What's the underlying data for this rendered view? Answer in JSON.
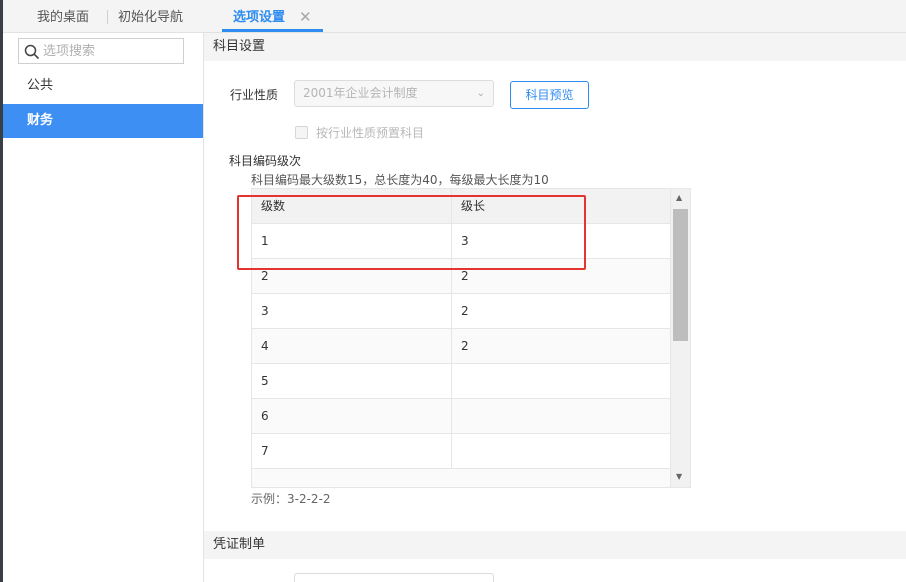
{
  "tabs": {
    "desktop": "我的桌面",
    "guide": "初始化导航",
    "options": "选项设置",
    "close_glyph": "✕"
  },
  "sidebar": {
    "search_placeholder": "选项搜索",
    "items": [
      {
        "label": "公共",
        "active": false
      },
      {
        "label": "财务",
        "active": true
      }
    ]
  },
  "main": {
    "section1_title": "科目设置",
    "industry_label": "行业性质",
    "industry_value": "2001年企业会计制度",
    "preview_button": "科目预览",
    "preset_checkbox_label": "按行业性质预置科目",
    "preset_checked": false,
    "code_level_label": "科目编码级次",
    "code_hint": "科目编码最大级数15，总长度为40，每级最大长度为10",
    "table": {
      "headers": [
        "级数",
        "级长"
      ],
      "rows": [
        [
          "1",
          "3"
        ],
        [
          "2",
          "2"
        ],
        [
          "3",
          "2"
        ],
        [
          "4",
          "2"
        ],
        [
          "5",
          ""
        ],
        [
          "6",
          ""
        ],
        [
          "7",
          ""
        ]
      ]
    },
    "example": "示例：3-2-2-2",
    "section2_title": "凭证制单"
  },
  "colors": {
    "accent": "#2d8cf0",
    "sidebar_active_bg": "#3e8ff3",
    "highlight": "#e3342f"
  }
}
